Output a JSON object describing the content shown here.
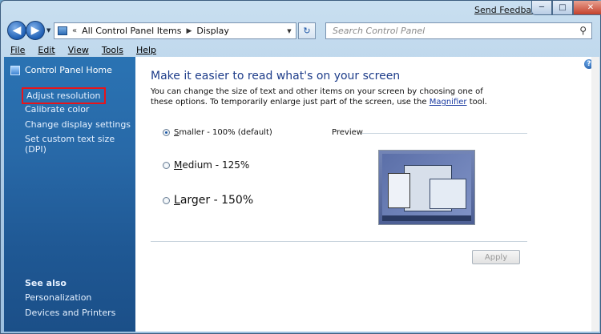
{
  "window": {
    "send_feedback": "Send Feedback",
    "controls": {
      "minimize": "─",
      "maximize": "□",
      "close": "✕"
    }
  },
  "nav": {
    "back_icon": "◀",
    "forward_icon": "▶",
    "dropdown_icon": "▼",
    "breadcrumb_lead": "«",
    "breadcrumb": [
      "All Control Panel Items",
      "Display"
    ],
    "crumb_arrow": "▶",
    "refresh_icon": "↻"
  },
  "search": {
    "placeholder": "Search Control Panel",
    "icon": "⚲"
  },
  "menu": [
    "File",
    "Edit",
    "View",
    "Tools",
    "Help"
  ],
  "sidebar": {
    "home": "Control Panel Home",
    "tasks": [
      "Adjust resolution",
      "Calibrate color",
      "Change display settings",
      "Set custom text size (DPI)"
    ],
    "see_also_title": "See also",
    "see_also": [
      "Personalization",
      "Devices and Printers"
    ]
  },
  "main": {
    "help_icon": "?",
    "heading": "Make it easier to read what's on your screen",
    "intro_1": "You can change the size of text and other items on your screen by choosing one of these options. To temporarily enlarge just part of the screen, use the ",
    "intro_link": "Magnifier",
    "intro_2": " tool.",
    "options": [
      {
        "first": "S",
        "rest": "maller - 100% (default)",
        "selected": true
      },
      {
        "first": "M",
        "rest": "edium - 125%",
        "selected": false
      },
      {
        "first": "L",
        "rest": "arger - 150%",
        "selected": false
      }
    ],
    "preview_label": "Preview",
    "apply_label": "Apply"
  },
  "highlight_color": "#e8141a"
}
